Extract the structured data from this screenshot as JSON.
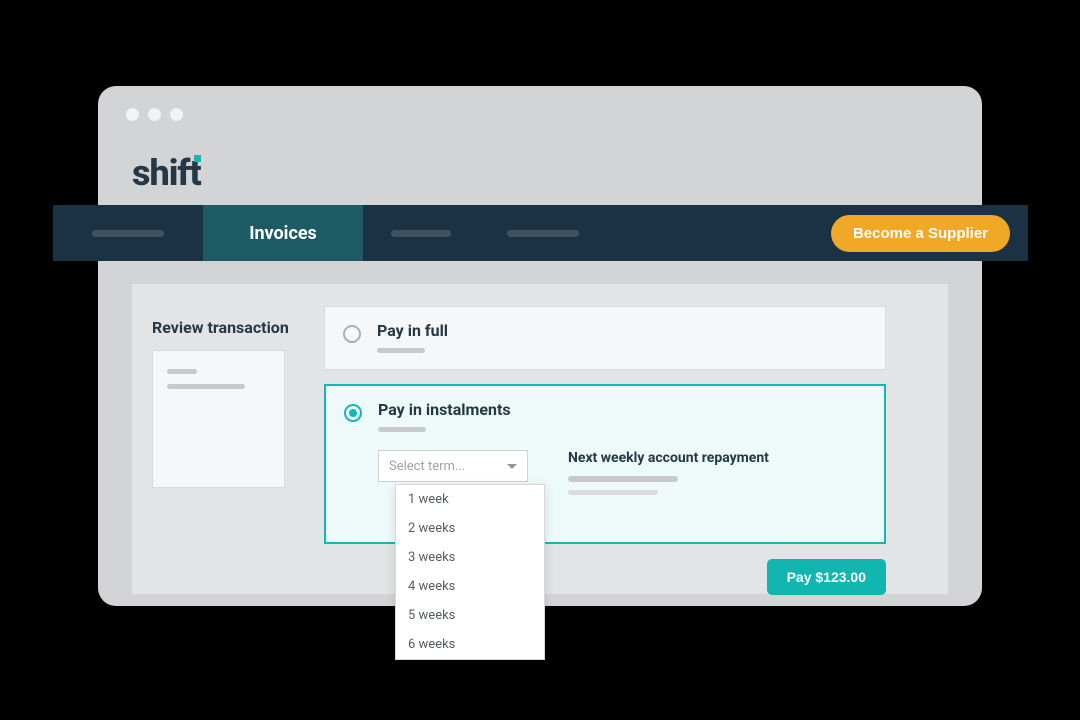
{
  "logo": "shift",
  "nav": {
    "active_label": "Invoices",
    "supplier_btn": "Become a Supplier"
  },
  "section_title": "Review transaction",
  "options": {
    "full": {
      "title": "Pay in full"
    },
    "instalments": {
      "title": "Pay in instalments",
      "select_placeholder": "Select term...",
      "repayment_title": "Next weekly account repayment",
      "terms": [
        "1 week",
        "2 weeks",
        "3 weeks",
        "4 weeks",
        "5 weeks",
        "6 weeks"
      ]
    }
  },
  "pay_button": "Pay $123.00"
}
